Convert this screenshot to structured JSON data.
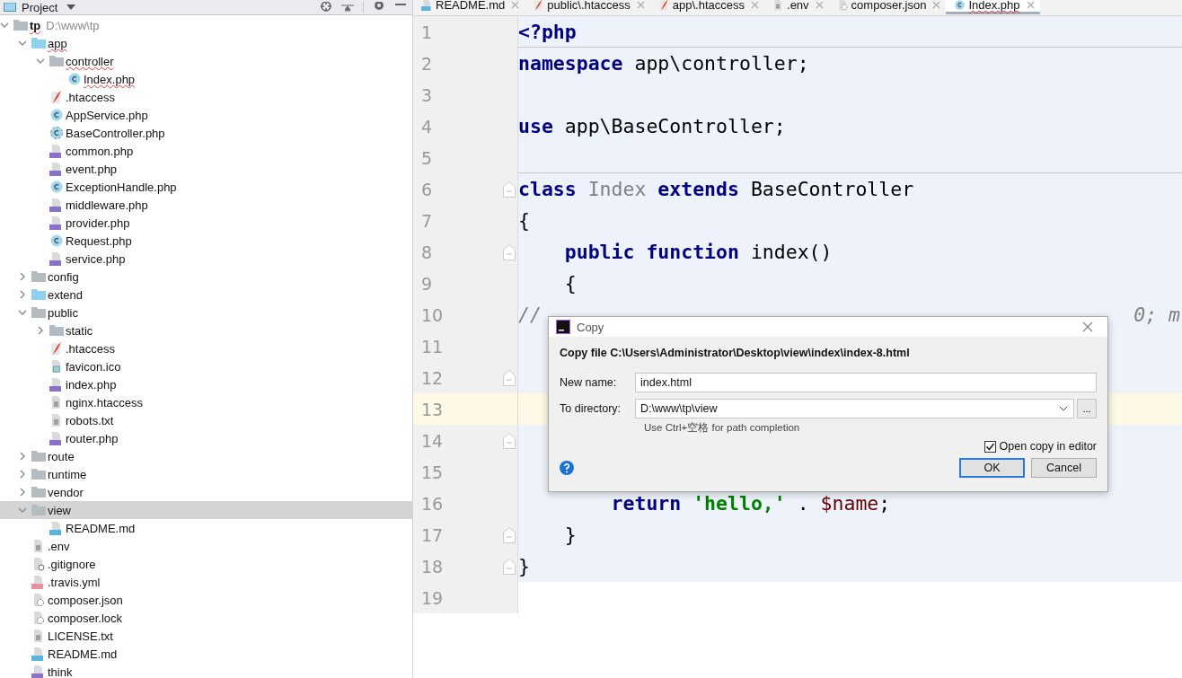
{
  "project_panel": {
    "title": "Project",
    "tree": [
      {
        "name": "tp",
        "path": "D:\\www\\tp",
        "kind": "folder",
        "expanded": true,
        "selected": false,
        "misspelled": true,
        "children": [
          {
            "name": "app",
            "kind": "source-folder",
            "expanded": true,
            "selected": false,
            "misspelled": true,
            "children": [
              {
                "name": "controller",
                "kind": "folder",
                "expanded": true,
                "selected": false,
                "misspelled": true,
                "children": [
                  {
                    "name": "Index.php",
                    "kind": "class",
                    "selected": false,
                    "misspelled": true
                  }
                ]
              },
              {
                "name": ".htaccess",
                "kind": "apache",
                "selected": false,
                "misspelled": false
              },
              {
                "name": "AppService.php",
                "kind": "class",
                "selected": false,
                "misspelled": false
              },
              {
                "name": "BaseController.php",
                "kind": "abstract-class",
                "selected": false,
                "misspelled": false
              },
              {
                "name": "common.php",
                "kind": "php",
                "selected": false,
                "misspelled": false
              },
              {
                "name": "event.php",
                "kind": "php",
                "selected": false,
                "misspelled": false
              },
              {
                "name": "ExceptionHandle.php",
                "kind": "class",
                "selected": false,
                "misspelled": false
              },
              {
                "name": "middleware.php",
                "kind": "php",
                "selected": false,
                "misspelled": false
              },
              {
                "name": "provider.php",
                "kind": "php",
                "selected": false,
                "misspelled": false
              },
              {
                "name": "Request.php",
                "kind": "class",
                "selected": false,
                "misspelled": false
              },
              {
                "name": "service.php",
                "kind": "php",
                "selected": false,
                "misspelled": false
              }
            ]
          },
          {
            "name": "config",
            "kind": "folder",
            "expanded": false,
            "selected": false,
            "misspelled": false
          },
          {
            "name": "extend",
            "kind": "source-folder",
            "expanded": false,
            "selected": false,
            "misspelled": false
          },
          {
            "name": "public",
            "kind": "folder",
            "expanded": true,
            "selected": false,
            "misspelled": false,
            "children": [
              {
                "name": "static",
                "kind": "folder",
                "expanded": false,
                "selected": false,
                "misspelled": false
              },
              {
                "name": ".htaccess",
                "kind": "apache",
                "selected": false,
                "misspelled": false
              },
              {
                "name": "favicon.ico",
                "kind": "image",
                "selected": false,
                "misspelled": false
              },
              {
                "name": "index.php",
                "kind": "php",
                "selected": false,
                "misspelled": false
              },
              {
                "name": "nginx.htaccess",
                "kind": "text",
                "selected": false,
                "misspelled": false
              },
              {
                "name": "robots.txt",
                "kind": "text",
                "selected": false,
                "misspelled": false
              },
              {
                "name": "router.php",
                "kind": "php",
                "selected": false,
                "misspelled": false
              }
            ]
          },
          {
            "name": "route",
            "kind": "folder",
            "expanded": false,
            "selected": false,
            "misspelled": false
          },
          {
            "name": "runtime",
            "kind": "folder",
            "expanded": false,
            "selected": false,
            "misspelled": false
          },
          {
            "name": "vendor",
            "kind": "folder",
            "expanded": false,
            "selected": false,
            "misspelled": false
          },
          {
            "name": "view",
            "kind": "folder",
            "expanded": true,
            "selected": true,
            "misspelled": false,
            "children": [
              {
                "name": "README.md",
                "kind": "markdown",
                "selected": false,
                "misspelled": false
              }
            ]
          },
          {
            "name": ".env",
            "kind": "text",
            "selected": false,
            "misspelled": false
          },
          {
            "name": ".gitignore",
            "kind": "ignore",
            "selected": false,
            "misspelled": false
          },
          {
            "name": ".travis.yml",
            "kind": "yaml",
            "selected": false,
            "misspelled": false
          },
          {
            "name": "composer.json",
            "kind": "json",
            "selected": false,
            "misspelled": false
          },
          {
            "name": "composer.lock",
            "kind": "json",
            "selected": false,
            "misspelled": false
          },
          {
            "name": "LICENSE.txt",
            "kind": "text",
            "selected": false,
            "misspelled": false
          },
          {
            "name": "README.md",
            "kind": "markdown",
            "selected": false,
            "misspelled": false
          },
          {
            "name": "think",
            "kind": "php",
            "selected": false,
            "misspelled": false
          }
        ]
      }
    ]
  },
  "editor": {
    "tabs": [
      {
        "label": "README.md",
        "kind": "markdown",
        "selected": false,
        "misspelled": false
      },
      {
        "label": "public\\.htaccess",
        "kind": "apache",
        "selected": false,
        "misspelled": false
      },
      {
        "label": "app\\.htaccess",
        "kind": "apache",
        "selected": false,
        "misspelled": false
      },
      {
        "label": ".env",
        "kind": "text",
        "selected": false,
        "misspelled": false
      },
      {
        "label": "composer.json",
        "kind": "json",
        "selected": false,
        "misspelled": false
      },
      {
        "label": "Index.php",
        "kind": "class",
        "selected": true,
        "misspelled": true
      }
    ],
    "lines": [
      {
        "number": "1",
        "tokens": [
          {
            "text": "<?php",
            "kind": "keyword"
          }
        ],
        "fold": false,
        "separator": true,
        "current": false,
        "scoped": true
      },
      {
        "number": "2",
        "tokens": [
          {
            "text": "namespace",
            "kind": "keyword"
          },
          {
            "text": " app\\controller;",
            "kind": "plain"
          }
        ],
        "fold": false,
        "separator": false,
        "current": false,
        "scoped": true
      },
      {
        "number": "3",
        "fold": false,
        "separator": false,
        "current": false,
        "scoped": true
      },
      {
        "number": "4",
        "tokens": [
          {
            "text": "use",
            "kind": "keyword"
          },
          {
            "text": " app\\BaseController;",
            "kind": "plain"
          }
        ],
        "fold": false,
        "separator": false,
        "current": false,
        "scoped": true
      },
      {
        "number": "5",
        "fold": false,
        "separator": true,
        "current": false,
        "scoped": true
      },
      {
        "number": "6",
        "tokens": [
          {
            "text": "class",
            "kind": "keyword"
          },
          {
            "text": " Index ",
            "kind": "class-name"
          },
          {
            "text": "extends",
            "kind": "keyword"
          },
          {
            "text": " BaseController",
            "kind": "plain"
          }
        ],
        "fold": true,
        "separator": false,
        "current": false,
        "scoped": true
      },
      {
        "number": "7",
        "tokens": [
          {
            "text": "{",
            "kind": "plain"
          }
        ],
        "fold": false,
        "separator": false,
        "current": false,
        "scoped": true
      },
      {
        "number": "8",
        "tokens": [
          {
            "text": "    public function",
            "kind": "keyword"
          },
          {
            "text": " index()",
            "kind": "plain"
          }
        ],
        "fold": true,
        "separator": false,
        "current": false,
        "scoped": true
      },
      {
        "number": "9",
        "tokens": [
          {
            "text": "    {",
            "kind": "plain"
          }
        ],
        "fold": false,
        "separator": false,
        "current": false,
        "scoped": true
      },
      {
        "number": "10",
        "tokens": [
          {
            "text": "//",
            "kind": "comment"
          },
          {
            "text": "0; m",
            "kind": "comment-end"
          }
        ],
        "fold": false,
        "separator": false,
        "current": false,
        "scoped": true
      },
      {
        "number": "11",
        "fold": false,
        "separator": false,
        "current": false,
        "scoped": true
      },
      {
        "number": "12",
        "fold": true,
        "separator": false,
        "current": false,
        "scoped": true
      },
      {
        "number": "13",
        "fold": false,
        "separator": false,
        "current": true,
        "scoped": true
      },
      {
        "number": "14",
        "fold": true,
        "separator": false,
        "current": false,
        "scoped": true
      },
      {
        "number": "15",
        "fold": false,
        "separator": false,
        "current": false,
        "scoped": true
      },
      {
        "number": "16",
        "tokens": [
          {
            "text": "        return",
            "kind": "keyword"
          },
          {
            "text": " 'hello,'",
            "kind": "string"
          },
          {
            "text": " . ",
            "kind": "plain"
          },
          {
            "text": "$name",
            "kind": "variable"
          },
          {
            "text": ";",
            "kind": "plain"
          }
        ],
        "fold": false,
        "separator": false,
        "current": false,
        "scoped": true
      },
      {
        "number": "17",
        "tokens": [
          {
            "text": "    }",
            "kind": "plain"
          }
        ],
        "fold": true,
        "separator": false,
        "current": false,
        "scoped": true
      },
      {
        "number": "18",
        "tokens": [
          {
            "text": "}",
            "kind": "plain"
          }
        ],
        "fold": true,
        "separator": false,
        "current": false,
        "scoped": true
      },
      {
        "number": "19",
        "fold": false,
        "separator": false,
        "current": false,
        "scoped": false
      }
    ]
  },
  "dialog": {
    "title": "Copy",
    "heading": "Copy file C:\\Users\\Administrator\\Desktop\\view\\index\\index-8.html",
    "new_name": {
      "label": "New name:",
      "value": "index.html"
    },
    "to_directory": {
      "label": "To directory:",
      "value": "D:\\www\\tp\\view",
      "browse": "..."
    },
    "hint": "Use Ctrl+空格 for path completion",
    "open_copy": {
      "label": "Open copy in editor",
      "checked": true
    },
    "buttons": [
      {
        "label": "OK",
        "kind": "default"
      },
      {
        "label": "Cancel",
        "kind": "normal"
      }
    ]
  }
}
